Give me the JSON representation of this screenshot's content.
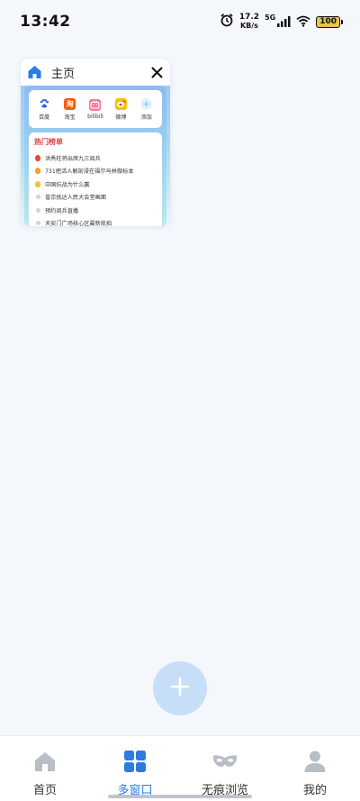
{
  "status_bar": {
    "time": "13:42",
    "speed_value": "17.2",
    "speed_unit": "KB/s",
    "network": "5G",
    "battery": "100",
    "icons": [
      "alarm-icon",
      "signal-icon",
      "wifi-icon",
      "battery-icon"
    ]
  },
  "window_card": {
    "title": "主页",
    "icons": {
      "home": "home-icon",
      "close": "close-icon"
    },
    "shortcuts": [
      {
        "label": "百度",
        "icon": "baidu-icon",
        "color": "#2b5fe0"
      },
      {
        "label": "淘宝",
        "icon": "taobao-icon",
        "color": "#ff5a00",
        "glyph": "淘"
      },
      {
        "label": "bilibili",
        "icon": "bilibili-icon",
        "color": "#fb7299"
      },
      {
        "label": "微博",
        "icon": "weibo-icon",
        "color": "#f5c400"
      },
      {
        "label": "添加",
        "icon": "add-icon",
        "color": "#d9eefb"
      }
    ],
    "hotlist": {
      "title": "热门榜单",
      "items": [
        {
          "text": "洪秀柱将出席九三阅兵",
          "rank_color": "#f0442a"
        },
        {
          "text": "731把活人解剖浸在福尔马林做标本",
          "rank_color": "#f79a2b"
        },
        {
          "text": "中国抗战为什么赢",
          "rank_color": "#f6c23a"
        },
        {
          "text": "普京抵达人民大会堂画面",
          "rank_color": ""
        },
        {
          "text": "预约阅兵直播",
          "rank_color": ""
        },
        {
          "text": "天安门广场核心区最新航拍",
          "rank_color": ""
        }
      ]
    }
  },
  "fab": {
    "icon": "plus-icon"
  },
  "bottom_nav": {
    "active_index": 1,
    "accent": "#2a7be4",
    "items": [
      {
        "label": "首页",
        "icon": "home-icon"
      },
      {
        "label": "多窗口",
        "icon": "windows-grid-icon"
      },
      {
        "label": "无痕浏览",
        "icon": "mask-icon"
      },
      {
        "label": "我的",
        "icon": "user-icon"
      }
    ]
  }
}
